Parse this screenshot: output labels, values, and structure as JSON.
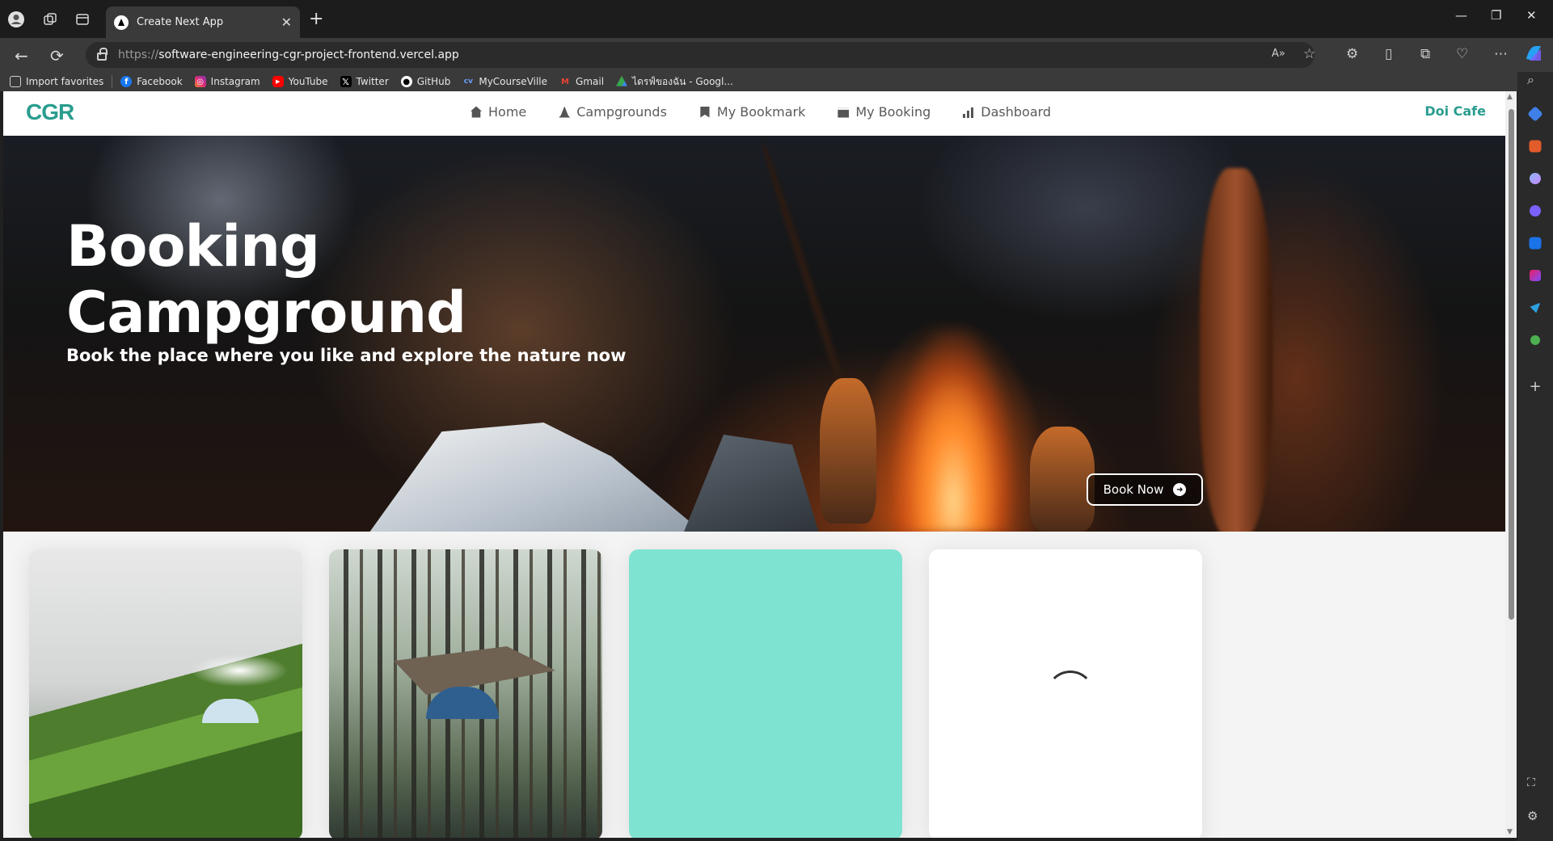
{
  "browser": {
    "tab_title": "Create Next App",
    "url_protocol": "https://",
    "url_host": "software-engineering-cgr-project-frontend.vercel.app",
    "bookmarks": [
      {
        "label": "Import favorites",
        "icon": "import-icon",
        "color": "#cfcfcf"
      },
      {
        "label": "Facebook",
        "icon": "facebook-icon",
        "color": "#1877f2"
      },
      {
        "label": "Instagram",
        "icon": "instagram-icon",
        "color": "#e1306c"
      },
      {
        "label": "YouTube",
        "icon": "youtube-icon",
        "color": "#ff0000"
      },
      {
        "label": "Twitter",
        "icon": "x-icon",
        "color": "#000000"
      },
      {
        "label": "GitHub",
        "icon": "github-icon",
        "color": "#ffffff"
      },
      {
        "label": "MyCourseVille",
        "icon": "mycourseville-icon",
        "color": "#2c6bd8"
      },
      {
        "label": "Gmail",
        "icon": "gmail-icon",
        "color": "#ea4335"
      },
      {
        "label": "ไดรฟ์ของฉัน - Googl...",
        "icon": "google-drive-icon",
        "color": "#34a853"
      }
    ]
  },
  "site": {
    "logo": "CGR",
    "nav": [
      {
        "label": "Home",
        "icon": "home-icon"
      },
      {
        "label": "Campgrounds",
        "icon": "campground-icon"
      },
      {
        "label": "My Bookmark",
        "icon": "bookmark-icon"
      },
      {
        "label": "My Booking",
        "icon": "calendar-icon"
      },
      {
        "label": "Dashboard",
        "icon": "bar-chart-icon"
      }
    ],
    "user_name": "Doi Cafe",
    "brand_color": "#2a9d8f"
  },
  "hero": {
    "title_line1": "Booking",
    "title_line2": "Campground",
    "subtitle": "Book the place where you like and explore the nature now",
    "cta_label": "Book Now"
  },
  "cards": [
    {
      "kind": "image",
      "description_icon": "photo-hillside-tents"
    },
    {
      "kind": "image",
      "description_icon": "photo-pine-forest-camp"
    },
    {
      "kind": "placeholder",
      "color": "#7fe3d2"
    },
    {
      "kind": "loading",
      "color": "#ffffff"
    }
  ]
}
